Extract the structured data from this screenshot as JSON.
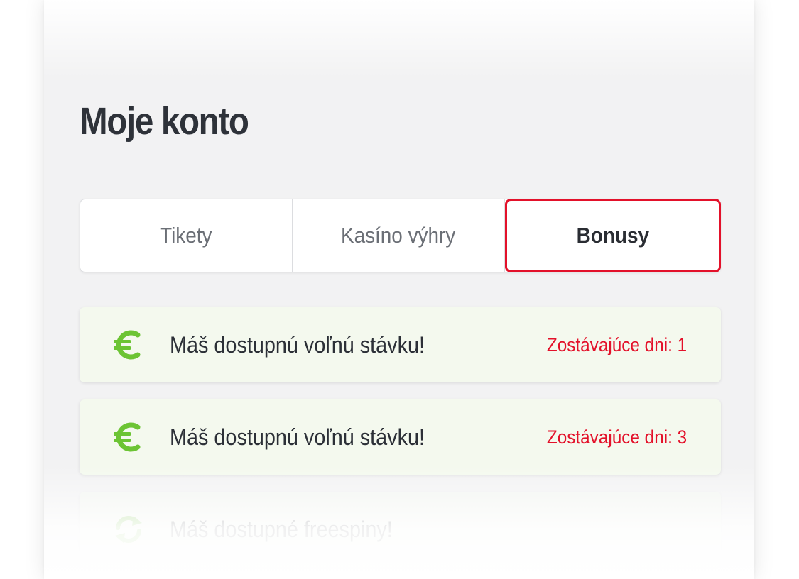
{
  "page": {
    "title": "Moje konto"
  },
  "tabs": [
    {
      "label": "Tikety",
      "active": false
    },
    {
      "label": "Kasíno výhry",
      "active": false
    },
    {
      "label": "Bonusy",
      "active": true
    }
  ],
  "bonuses": [
    {
      "icon": "euro-icon",
      "text": "Máš dostupnú voľnú stávku!",
      "days": "Zostávajúce dni: 1"
    },
    {
      "icon": "euro-icon",
      "text": "Máš dostupnú voľnú stávku!",
      "days": "Zostávajúce dni: 3"
    },
    {
      "icon": "refresh-icon",
      "text": "Máš dostupné freespiny!",
      "days": ""
    }
  ],
  "colors": {
    "accent_red": "#e3112a",
    "icon_green": "#6cc434",
    "card_background": "#f4f9ee",
    "title_text": "#2e3239"
  }
}
